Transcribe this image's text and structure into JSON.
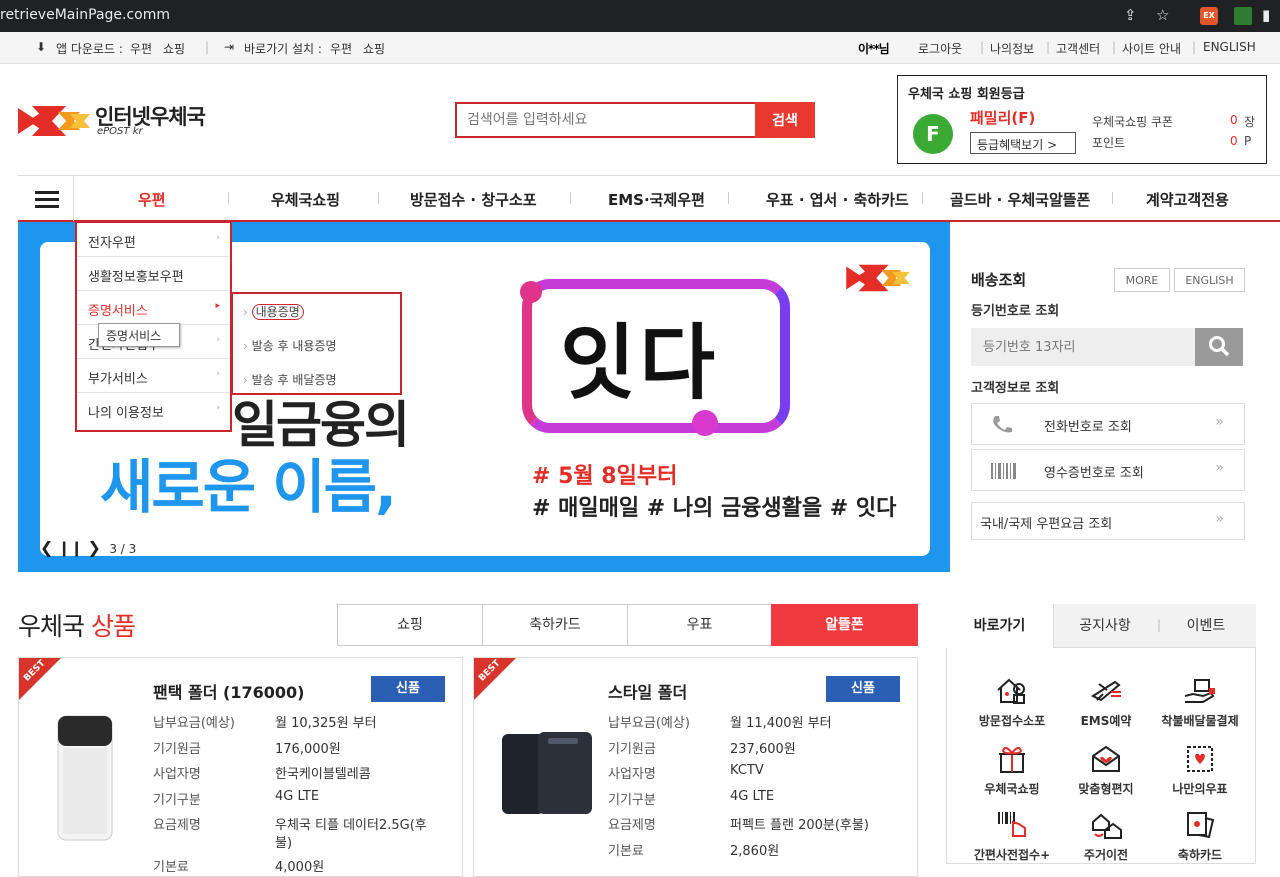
{
  "browser": {
    "url": "retrieveMainPage.comm"
  },
  "util_bar": {
    "app_download": "앱 다운로드 :",
    "app_post": "우편",
    "app_shop": "쇼핑",
    "shortcut_install": "바로가기 설치 :",
    "sc_post": "우편",
    "sc_shop": "쇼핑",
    "username": "이**님",
    "logout": "로그아웃",
    "myinfo": "나의정보",
    "support": "고객센터",
    "site_guide": "사이트 안내",
    "english": "ENGLISH"
  },
  "header": {
    "logo_text": "인터넷우체국",
    "logo_sub": "ePOST kr",
    "search_placeholder": "검색어를 입력하세요",
    "search_btn": "검색"
  },
  "grade": {
    "title": "우체국 쇼핑 회원등급",
    "badge": "F",
    "level": "패밀리(F)",
    "benefit_btn": "등급혜택보기",
    "coupon_label": "우체국쇼핑 쿠폰",
    "coupon_val": "0",
    "coupon_unit": "장",
    "point_label": "포인트",
    "point_val": "0",
    "point_unit": "P"
  },
  "nav": {
    "items": [
      "우편",
      "우체국쇼핑",
      "방문접수 · 창구소포",
      "EMS·국제우편",
      "우표 · 엽서 · 축하카드",
      "골드바 · 우체국알뜰폰",
      "계약고객전용"
    ]
  },
  "dropdown": {
    "items": [
      "전자우편",
      "생활정보홍보우편",
      "증명서비스",
      "간편사전접수",
      "부가서비스",
      "나의 이용정보"
    ],
    "sub": [
      "내용증명",
      "발송 후 내용증명",
      "발송 후 배달증명"
    ],
    "tooltip": "증명서비스"
  },
  "banner": {
    "line1": "일금융의",
    "line2": "새로운 이름,",
    "logo": "잇다",
    "hash1": "# 5월 8일부터",
    "hash2": "# 매일매일 # 나의 금융생활을 # 잇다",
    "page": "3 / 3"
  },
  "delivery": {
    "title": "배송조회",
    "more": "MORE",
    "english": "ENGLISH",
    "reg_label": "등기번호로 조회",
    "reg_placeholder": "등기번호 13자리",
    "cust_label": "고객정보로 조회",
    "phone": "전화번호로 조회",
    "receipt": "영수증번호로 조회",
    "postage": "국내/국제 우편요금 조회"
  },
  "products": {
    "title_a": "우체국",
    "title_b": "상품",
    "tabs": [
      "쇼핑",
      "축하카드",
      "우표",
      "알뜰폰"
    ],
    "best": "BEST",
    "new": "신품",
    "spec_labels": [
      "납부요금(예상)",
      "기기원금",
      "사업자명",
      "기기구분",
      "요금제명",
      "기본료"
    ],
    "p1": {
      "name": "팬택 폴더 (176000)",
      "vals": [
        "월 10,325원 부터",
        "176,000원",
        "한국케이블텔레콤",
        "4G LTE",
        "우체국 티플 데이터2.5G(후",
        "불)",
        "4,000원"
      ]
    },
    "p2": {
      "name": "스타일 폴더",
      "vals": [
        "월 11,400원 부터",
        "237,600원",
        "KCTV",
        "4G LTE",
        "퍼펙트 플랜 200분(후불)",
        "2,860원"
      ]
    }
  },
  "shortcuts": {
    "tabs": [
      "바로가기",
      "공지사항",
      "이벤트"
    ],
    "items": [
      "방문접수소포",
      "EMS예약",
      "착불배달물결제",
      "우체국쇼핑",
      "맞춤형편지",
      "나만의우표",
      "간편사전접수+",
      "주거이전",
      "축하카드"
    ]
  },
  "colors": {
    "brand_red": "#c8262c",
    "banner_blue": "#1e96ed",
    "new_blue": "#2b5fb4"
  }
}
